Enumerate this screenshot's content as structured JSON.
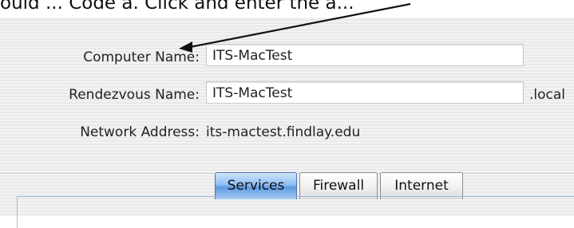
{
  "caption": {
    "text": "ould ... Code a. Click and enter the a..."
  },
  "sharing": {
    "computer_name": {
      "label": "Computer Name:",
      "value": "ITS-MacTest"
    },
    "rendezvous_name": {
      "label": "Rendezvous Name:",
      "value": "ITS-MacTest",
      "suffix": ".local"
    },
    "network_address": {
      "label": "Network Address:",
      "value": "its-mactest.findlay.edu"
    },
    "tabs": [
      {
        "label": "Services",
        "selected": true
      },
      {
        "label": "Firewall",
        "selected": false
      },
      {
        "label": "Internet",
        "selected": false
      }
    ]
  },
  "colors": {
    "selected_tab": "#7fb2ec",
    "tab_border": "#8a8a8a",
    "panel_stripe": "#e9e9e9"
  },
  "annotation": {
    "icon": "arrow-pointer"
  }
}
